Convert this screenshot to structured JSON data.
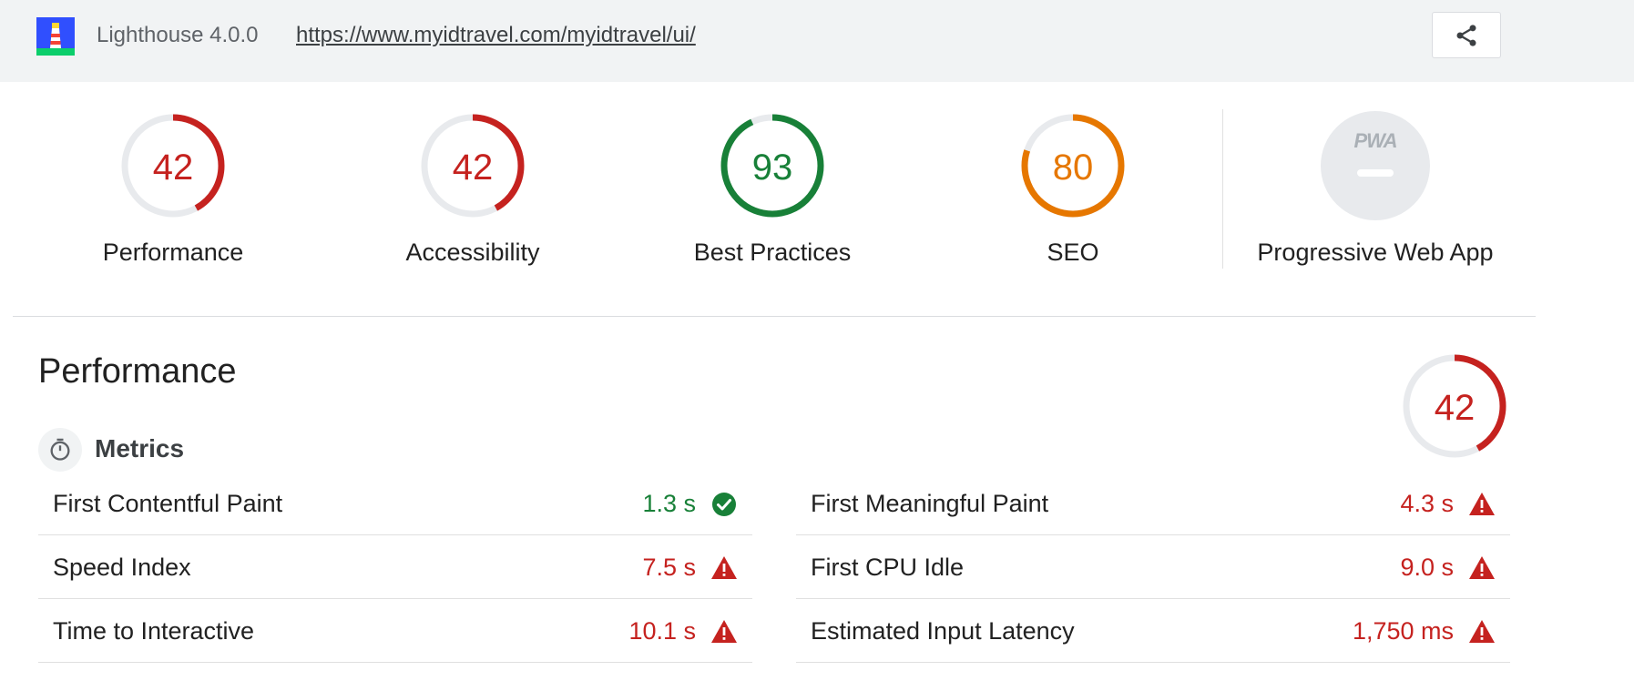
{
  "header": {
    "version": "Lighthouse 4.0.0",
    "url": "https://www.myidtravel.com/myidtravel/ui/",
    "share_icon": "share-icon",
    "logo_icon": "lighthouse-logo"
  },
  "colors": {
    "fail": "#c5221f",
    "average": "#e67700",
    "pass": "#188038",
    "track": "#e8eaed"
  },
  "categories": [
    {
      "label": "Performance",
      "score": 42,
      "status": "fail"
    },
    {
      "label": "Accessibility",
      "score": 42,
      "status": "fail"
    },
    {
      "label": "Best Practices",
      "score": 93,
      "status": "pass"
    },
    {
      "label": "SEO",
      "score": 80,
      "status": "average"
    }
  ],
  "pwa": {
    "badge_text": "PWA",
    "label": "Progressive Web App"
  },
  "performance": {
    "title": "Performance",
    "score": 42,
    "metrics_title": "Metrics",
    "metrics_icon": "stopwatch-icon",
    "metrics": [
      {
        "label": "First Contentful Paint",
        "value": "1.3 s",
        "status": "pass",
        "icon": "check-circle-icon"
      },
      {
        "label": "First Meaningful Paint",
        "value": "4.3 s",
        "status": "fail",
        "icon": "warning-triangle-icon"
      },
      {
        "label": "Speed Index",
        "value": "7.5 s",
        "status": "fail",
        "icon": "warning-triangle-icon"
      },
      {
        "label": "First CPU Idle",
        "value": "9.0 s",
        "status": "fail",
        "icon": "warning-triangle-icon"
      },
      {
        "label": "Time to Interactive",
        "value": "10.1 s",
        "status": "fail",
        "icon": "warning-triangle-icon"
      },
      {
        "label": "Estimated Input Latency",
        "value": "1,750 ms",
        "status": "fail",
        "icon": "warning-triangle-icon"
      }
    ]
  }
}
